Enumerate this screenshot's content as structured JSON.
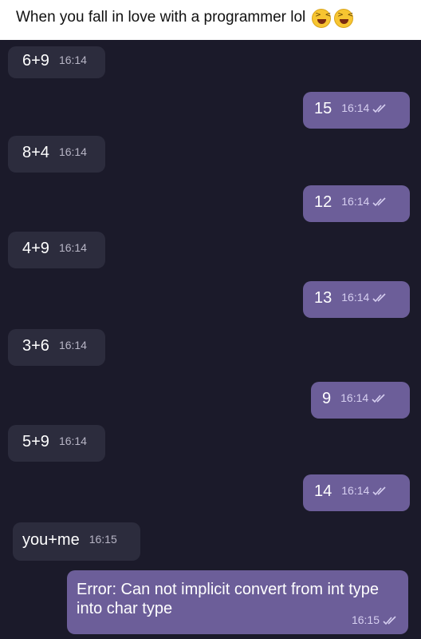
{
  "caption": {
    "text": "When you fall in love with a programmer lol",
    "emojis": [
      "laughing-face-icon",
      "laughing-face-icon"
    ]
  },
  "chat": {
    "messages": [
      {
        "side": "incoming",
        "text": "6+9",
        "time": "16:14"
      },
      {
        "side": "outgoing",
        "text": "15",
        "time": "16:14",
        "status": "read"
      },
      {
        "side": "incoming",
        "text": "8+4",
        "time": "16:14"
      },
      {
        "side": "outgoing",
        "text": "12",
        "time": "16:14",
        "status": "read"
      },
      {
        "side": "incoming",
        "text": "4+9",
        "time": "16:14"
      },
      {
        "side": "outgoing",
        "text": "13",
        "time": "16:14",
        "status": "read"
      },
      {
        "side": "incoming",
        "text": "3+6",
        "time": "16:14"
      },
      {
        "side": "outgoing",
        "text": "9",
        "time": "16:14",
        "status": "read"
      },
      {
        "side": "incoming",
        "text": "5+9",
        "time": "16:14"
      },
      {
        "side": "outgoing",
        "text": "14",
        "time": "16:14",
        "status": "read"
      },
      {
        "side": "incoming",
        "text": "you+me",
        "time": "16:15"
      },
      {
        "side": "outgoing",
        "text": "Error: Can not implicit convert from int type into char type",
        "time": "16:15",
        "status": "read"
      }
    ]
  },
  "colors": {
    "chat_background": "#1b1a2a",
    "incoming_bubble": "#2c2c3d",
    "outgoing_bubble": "#6c5e99"
  }
}
